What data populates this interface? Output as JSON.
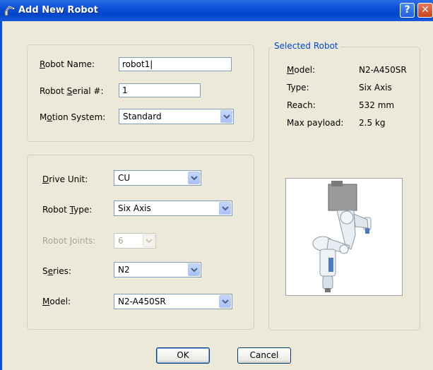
{
  "window": {
    "title": "Add New Robot",
    "help_label": "?",
    "close_label": "✕"
  },
  "robot": {
    "name_label_prefix": "",
    "name_label_mnemonic": "R",
    "name_label_rest": "obot Name:",
    "name_value": "robot1|",
    "serial_label_pre": "Robot ",
    "serial_label_mnemonic": "S",
    "serial_label_rest": "erial #:",
    "serial_value": "1",
    "motion_label_pre": "M",
    "motion_label_mnemonic": "o",
    "motion_label_rest": "tion System:",
    "motion_value": "Standard"
  },
  "drive": {
    "drive_unit_label_mnemonic": "D",
    "drive_unit_label_rest": "rive Unit:",
    "drive_unit_value": "CU",
    "robot_type_label_pre": "Robot ",
    "robot_type_label_mnemonic": "T",
    "robot_type_label_rest": "ype:",
    "robot_type_value": "Six Axis",
    "joints_label_pre": "Robot ",
    "joints_label_mnemonic": "J",
    "joints_label_rest": "oints:",
    "joints_value": "6",
    "series_label_pre": "S",
    "series_label_mnemonic": "e",
    "series_label_rest": "ries:",
    "series_value": "N2",
    "model_label_mnemonic": "M",
    "model_label_rest": "odel:",
    "model_value": "N2-A450SR"
  },
  "selected": {
    "legend": "Selected Robot",
    "model_label_mnemonic": "M",
    "model_label_rest": "odel:",
    "model_value": "N2-A450SR",
    "type_label": "Type:",
    "type_value": "Six Axis",
    "reach_label": "Reach:",
    "reach_value": "532 mm",
    "payload_label": "Max payload:",
    "payload_value": "2.5 kg"
  },
  "buttons": {
    "ok": "OK",
    "cancel": "Cancel"
  }
}
